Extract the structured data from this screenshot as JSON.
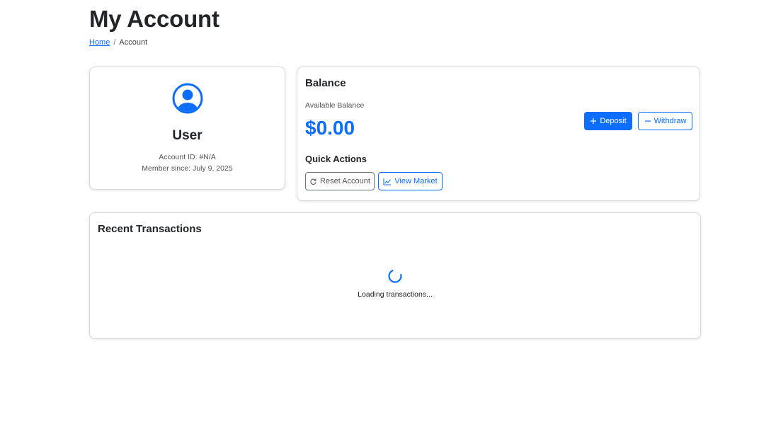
{
  "page": {
    "title": "My Account",
    "breadcrumb": {
      "home": "Home",
      "separator": "/",
      "current": "Account"
    }
  },
  "profile": {
    "avatar_icon": "user-circle-icon",
    "name": "User",
    "account_id": "Account ID: #N/A",
    "member_since": "Member since: July 9, 2025"
  },
  "balance": {
    "heading": "Balance",
    "available_label": "Available Balance",
    "amount": "$0.00",
    "deposit_label": "Deposit",
    "withdraw_label": "Withdraw",
    "quick_actions_heading": "Quick Actions",
    "reset_label": "Reset Account",
    "market_label": "View Market"
  },
  "transactions": {
    "heading": "Recent Transactions",
    "loading_text": "Loading transactions..."
  },
  "colors": {
    "primary": "#0d6efd",
    "text": "#212529",
    "muted": "#6c757d"
  }
}
